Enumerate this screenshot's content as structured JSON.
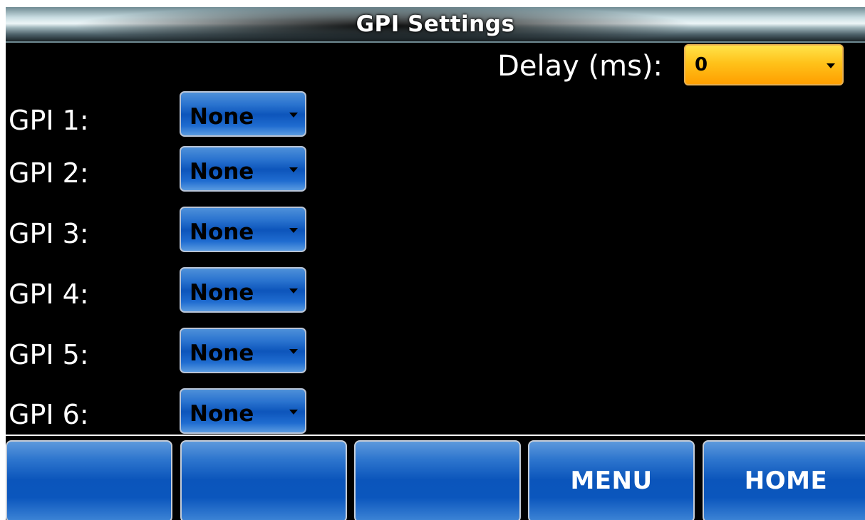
{
  "title": "GPI Settings",
  "delay": {
    "label": "Delay (ms):",
    "value": "0",
    "caret_icon": "chevron-down-icon"
  },
  "gpis": [
    {
      "label": "GPI 1:",
      "value": "None"
    },
    {
      "label": "GPI 2:",
      "value": "None"
    },
    {
      "label": "GPI 3:",
      "value": "None"
    },
    {
      "label": "GPI 4:",
      "value": "None"
    },
    {
      "label": "GPI 5:",
      "value": "None"
    },
    {
      "label": "GPI 6:",
      "value": "None"
    }
  ],
  "bottom_buttons": [
    {
      "label": ""
    },
    {
      "label": ""
    },
    {
      "label": ""
    },
    {
      "label": "MENU"
    },
    {
      "label": "HOME"
    }
  ],
  "colors": {
    "background": "#000000",
    "delay_dropdown": "#ffc21a",
    "gpi_dropdown": "#0d55bb",
    "bottom_button": "#0b55bb",
    "text": "#ffffff"
  }
}
